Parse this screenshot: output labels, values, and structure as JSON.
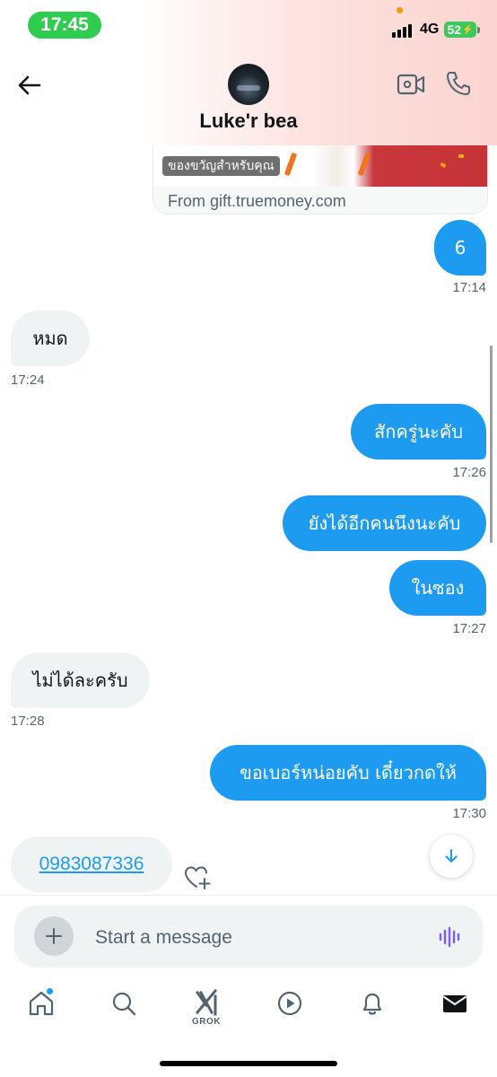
{
  "status_bar": {
    "time": "17:45",
    "network": "4G",
    "battery": "52"
  },
  "header": {
    "contact_name": "Luke'r bea",
    "back_icon": "arrow-left-icon",
    "video_icon": "video-camera-icon",
    "call_icon": "phone-icon"
  },
  "gift_card": {
    "caption": "ของขวัญสำหรับคุณ",
    "source": "From gift.truemoney.com"
  },
  "messages": [
    {
      "direction": "out",
      "text": "6",
      "time": "17:14"
    },
    {
      "direction": "in",
      "text": "หมด",
      "time": "17:24"
    },
    {
      "direction": "out",
      "text": "สักครู่นะคับ",
      "time": "17:26"
    },
    {
      "direction": "out",
      "text": "ยังได้อีกคนนึงนะคับ",
      "time": ""
    },
    {
      "direction": "out",
      "text": "ในซอง",
      "time": "17:27"
    },
    {
      "direction": "in",
      "text": "ไม่ได้ละครับ",
      "time": "17:28"
    },
    {
      "direction": "out",
      "text": "ขอเบอร์หน่อยคับ เดี๋ยวกดให้",
      "time": "17:30"
    },
    {
      "direction": "in",
      "text": "0983087336",
      "time": "",
      "is_link": true
    }
  ],
  "composer": {
    "placeholder": "Start a message",
    "add_icon": "plus-icon",
    "voice_icon": "voice-wave-icon"
  },
  "tabbar": {
    "items": [
      {
        "icon": "home-icon",
        "label": ""
      },
      {
        "icon": "search-icon",
        "label": ""
      },
      {
        "icon": "grok-icon",
        "label": "GROK"
      },
      {
        "icon": "play-icon",
        "label": ""
      },
      {
        "icon": "bell-icon",
        "label": ""
      },
      {
        "icon": "mail-icon",
        "label": ""
      }
    ]
  },
  "colors": {
    "accent": "#1d9bf0",
    "incoming_bubble": "#eff3f4",
    "muted_text": "#536471"
  }
}
